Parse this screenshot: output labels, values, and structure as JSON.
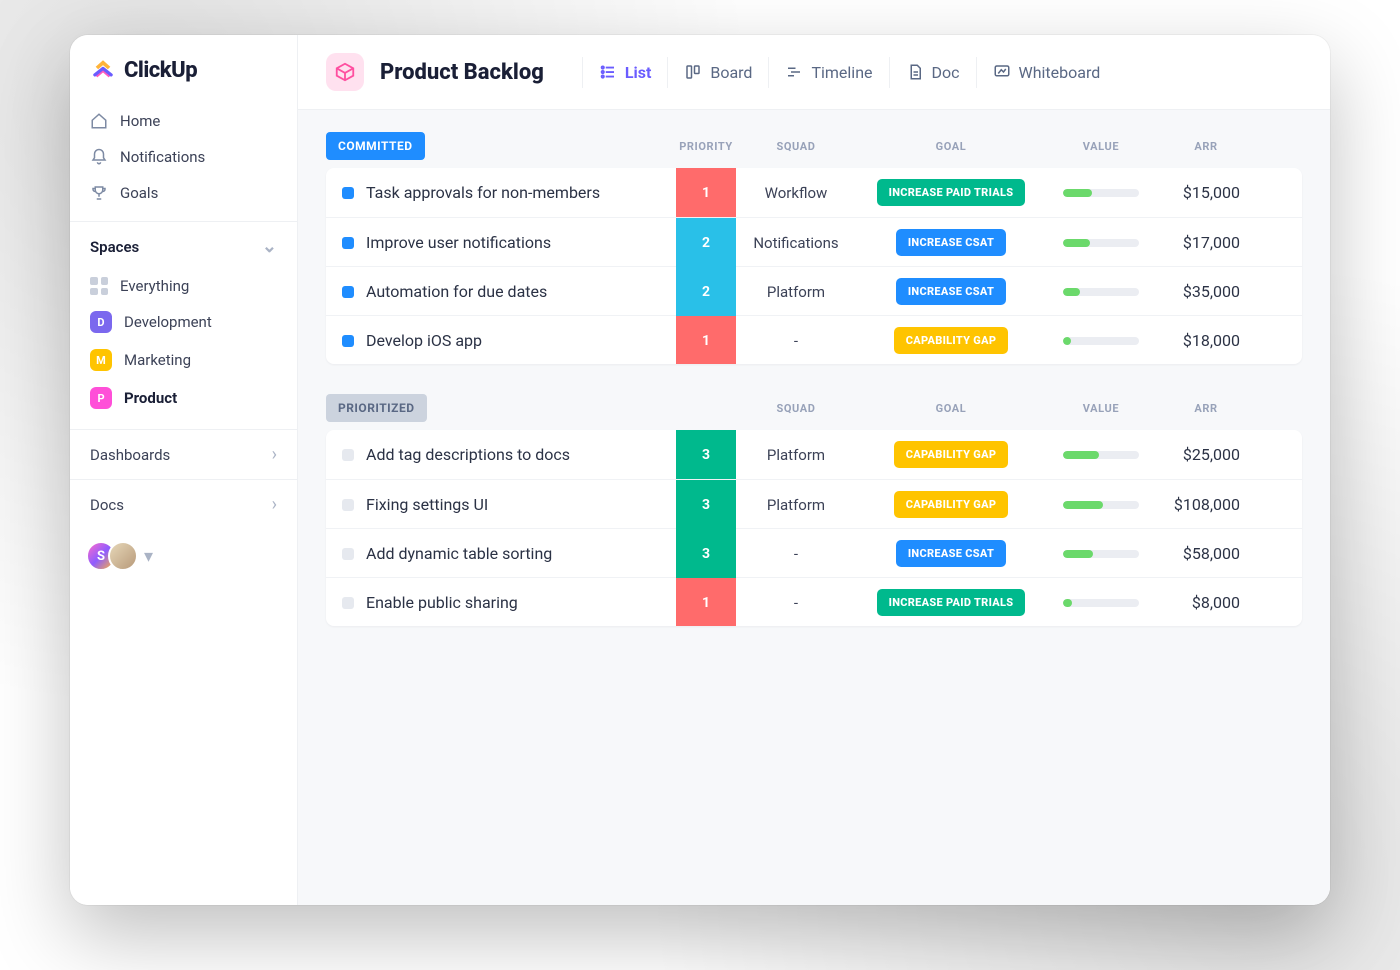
{
  "brand": "ClickUp",
  "nav": [
    {
      "icon": "home-icon",
      "label": "Home"
    },
    {
      "icon": "bell-icon",
      "label": "Notifications"
    },
    {
      "icon": "trophy-icon",
      "label": "Goals"
    }
  ],
  "spacesHeader": "Spaces",
  "spaces": [
    {
      "label": "Everything",
      "badge": null
    },
    {
      "label": "Development",
      "badge": "D",
      "color": "#7b68ee"
    },
    {
      "label": "Marketing",
      "badge": "M",
      "color": "#ffc400"
    },
    {
      "label": "Product",
      "badge": "P",
      "color": "#ff4fd8",
      "active": true
    }
  ],
  "footerLinks": [
    {
      "label": "Dashboards"
    },
    {
      "label": "Docs"
    }
  ],
  "avatars": [
    {
      "letter": "S"
    },
    {
      "letter": ""
    }
  ],
  "page": {
    "title": "Product Backlog",
    "views": [
      {
        "label": "List",
        "icon": "list-icon",
        "active": true
      },
      {
        "label": "Board",
        "icon": "board-icon"
      },
      {
        "label": "Timeline",
        "icon": "timeline-icon"
      },
      {
        "label": "Doc",
        "icon": "doc-icon"
      },
      {
        "label": "Whiteboard",
        "icon": "whiteboard-icon"
      }
    ]
  },
  "columns": {
    "priority": "PRIORITY",
    "squad": "SQUAD",
    "goal": "GOAL",
    "value": "VALUE",
    "arr": "ARR"
  },
  "groups": [
    {
      "name": "COMMITTED",
      "style": "blue",
      "showPriorityHeader": true,
      "bullet": "b-blue",
      "rows": [
        {
          "name": "Task approvals for non-members",
          "priority": "1",
          "prioClass": "p-red",
          "squad": "Workflow",
          "goal": "INCREASE PAID TRIALS",
          "goalClass": "g-green",
          "value": 38,
          "arr": "$15,000"
        },
        {
          "name": "Improve  user notifications",
          "priority": "2",
          "prioClass": "p-cyan",
          "squad": "Notifications",
          "goal": "INCREASE CSAT",
          "goalClass": "g-blue",
          "value": 36,
          "arr": "$17,000"
        },
        {
          "name": "Automation for due dates",
          "priority": "2",
          "prioClass": "p-cyan",
          "squad": "Platform",
          "goal": "INCREASE CSAT",
          "goalClass": "g-blue",
          "value": 22,
          "arr": "$35,000"
        },
        {
          "name": "Develop iOS app",
          "priority": "1",
          "prioClass": "p-red",
          "squad": "-",
          "goal": "CAPABILITY GAP",
          "goalClass": "g-yellow",
          "value": 10,
          "arr": "$18,000"
        }
      ]
    },
    {
      "name": "PRIORITIZED",
      "style": "grey",
      "showPriorityHeader": false,
      "bullet": "b-grey",
      "rows": [
        {
          "name": "Add tag descriptions to docs",
          "priority": "3",
          "prioClass": "p-green",
          "squad": "Platform",
          "goal": "CAPABILITY GAP",
          "goalClass": "g-yellow",
          "value": 48,
          "arr": "$25,000"
        },
        {
          "name": "Fixing settings UI",
          "priority": "3",
          "prioClass": "p-green",
          "squad": "Platform",
          "goal": "CAPABILITY GAP",
          "goalClass": "g-yellow",
          "value": 52,
          "arr": "$108,000"
        },
        {
          "name": "Add dynamic table sorting",
          "priority": "3",
          "prioClass": "p-green",
          "squad": "-",
          "goal": "INCREASE CSAT",
          "goalClass": "g-blue",
          "value": 40,
          "arr": "$58,000"
        },
        {
          "name": "Enable public sharing",
          "priority": "1",
          "prioClass": "p-red",
          "squad": "-",
          "goal": "INCREASE PAID TRIALS",
          "goalClass": "g-green",
          "value": 12,
          "arr": "$8,000"
        }
      ]
    }
  ]
}
